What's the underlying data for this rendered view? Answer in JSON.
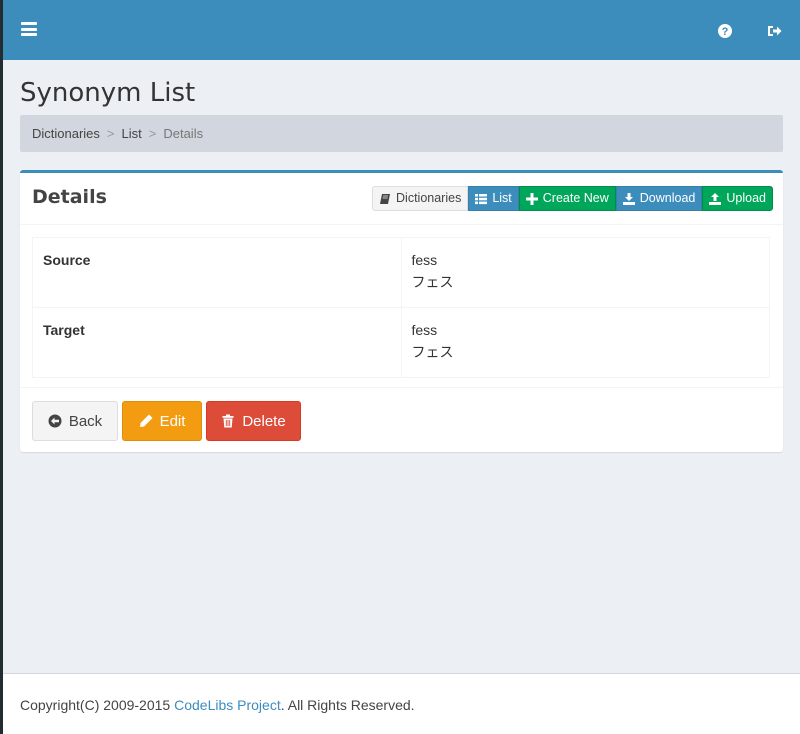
{
  "header": {
    "menu_icon": "hamburger-icon",
    "help_icon": "question-circle-icon",
    "logout_icon": "sign-out-icon",
    "color": "#3c8dbc"
  },
  "page": {
    "title": "Synonym List"
  },
  "breadcrumb": {
    "items": [
      "Dictionaries",
      "List"
    ],
    "active": "Details",
    "separator": ">"
  },
  "box": {
    "title": "Details",
    "buttons": [
      {
        "label": "Dictionaries",
        "icon": "book-icon"
      },
      {
        "label": "List",
        "icon": "list-icon"
      },
      {
        "label": "Create New",
        "icon": "plus-icon"
      },
      {
        "label": "Download",
        "icon": "download-icon"
      },
      {
        "label": "Upload",
        "icon": "upload-icon"
      }
    ],
    "rows": [
      {
        "label": "Source",
        "values": [
          "fess",
          "フェス"
        ]
      },
      {
        "label": "Target",
        "values": [
          "fess",
          "フェス"
        ]
      }
    ],
    "actions": {
      "back": "Back",
      "edit": "Edit",
      "delete": "Delete"
    }
  },
  "footer": {
    "prefix": "Copyright(C) 2009-2015 ",
    "link": "CodeLibs Project",
    "suffix": ". All Rights Reserved."
  }
}
